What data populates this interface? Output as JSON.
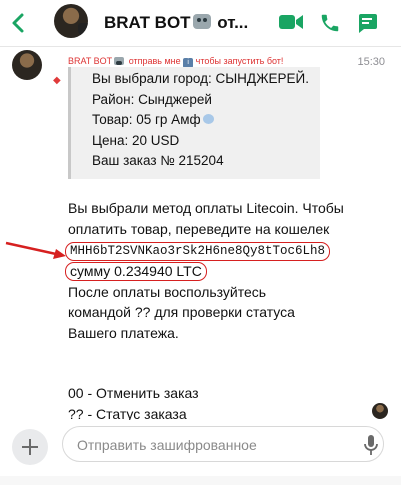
{
  "header": {
    "title_prefix": "BRAT BOT",
    "title_suffix": " от..."
  },
  "message": {
    "sender_prefix": "BRAT BOT",
    "sender_mid": " отправь мне ",
    "info_badge": "i",
    "sender_suffix": " чтобы запустить бот!",
    "time": "15:30",
    "quote_lines": [
      "Вы выбрали город: СЫНДЖЕРЕЙ.",
      "Район: Сынджерей",
      "Товар: 05 гр Амф",
      "Цена: 20 USD",
      "Ваш заказ № 215204"
    ],
    "body": {
      "line1": "Вы выбрали метод оплаты Litecoin. Чтобы",
      "line2": "оплатить товар, переведите на кошелек",
      "wallet": "MHH6bT2SVNKao3rSk2H6ne8Qy8tToc6Lh8",
      "amount": "сумму 0.234940 LTC",
      "line5": "После оплаты воспользуйтесь",
      "line6": "командой ?? для проверки статуса",
      "line7": "Вашего платежа.",
      "cmd1": "00 - Отменить заказ",
      "cmd2": "?? - Статус заказа"
    }
  },
  "input": {
    "placeholder": "Отправить зашифрованное"
  },
  "colors": {
    "accent": "#1aa563",
    "highlight": "#d62020",
    "sender": "#dd3333"
  },
  "icons": [
    "back-chevron-icon",
    "video-call-icon",
    "phone-icon",
    "chat-lines-icon",
    "shield-icon",
    "mic-icon",
    "plus-icon",
    "red-arrow-icon"
  ]
}
